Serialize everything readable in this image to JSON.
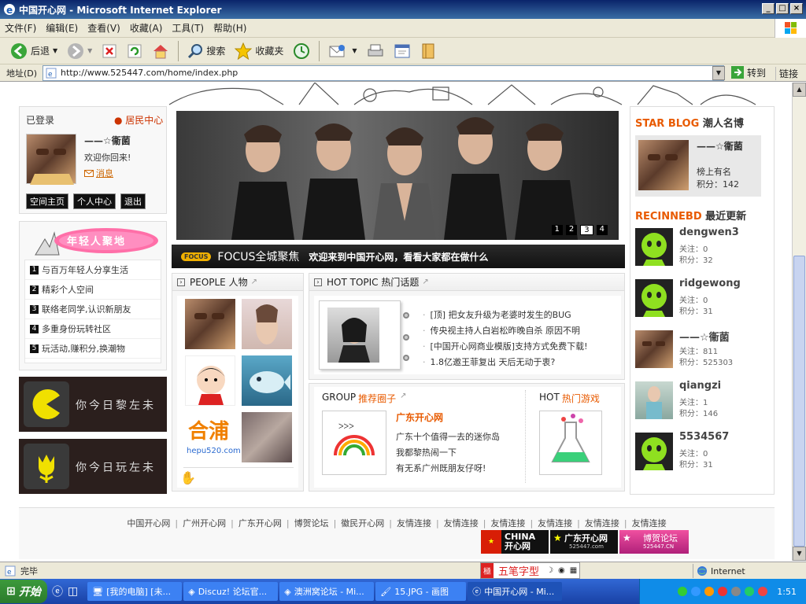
{
  "window": {
    "title": "中国开心网 - Microsoft Internet Explorer",
    "min": "_",
    "max": "□",
    "close": "×"
  },
  "menu": [
    "文件(F)",
    "编辑(E)",
    "查看(V)",
    "收藏(A)",
    "工具(T)",
    "帮助(H)"
  ],
  "toolbar": {
    "back": "后退",
    "search": "搜索",
    "favorites": "收藏夹"
  },
  "address": {
    "label": "地址(D)",
    "url": "http://www.525447.com/home/index.php",
    "go": "转到",
    "links": "链接"
  },
  "login": {
    "status": "已登录",
    "center": "居民中心",
    "name": "——☆衞菌",
    "welcome": "欢迎你回来!",
    "message": "消息",
    "btn_home": "空间主页",
    "btn_personal": "个人中心",
    "btn_logout": "退出"
  },
  "youth": {
    "banner_text": "年轻人聚地",
    "items": [
      {
        "n": "1",
        "t": "与百万年轻人分享生活"
      },
      {
        "n": "2",
        "t": "精彩个人空间"
      },
      {
        "n": "3",
        "t": "联络老同学,认识新朋友"
      },
      {
        "n": "4",
        "t": "多重身份玩转社区"
      },
      {
        "n": "5",
        "t": "玩活动,赚积分,换潮物"
      }
    ]
  },
  "promo": [
    "你今日黎左未",
    "你今日玩左未"
  ],
  "slider": {
    "pages": [
      "1",
      "2",
      "3",
      "4"
    ],
    "active": "3"
  },
  "focus": {
    "badge": "FOCUS",
    "title": "FOCUS全城聚焦",
    "text": "欢迎来到中国开心网，看看大家都在做什么"
  },
  "people": {
    "title": "PEOPLE 人物",
    "logo_text": "合浦",
    "logo_sub": "hepu520.com"
  },
  "hottopic": {
    "title": "HOT TOPIC 热门话题",
    "items": [
      "[顶] 把女友升级为老婆时发生的BUG",
      "传央视主持人白岩松昨晚自杀 原因不明",
      "[中国开心网商业模版]支持方式免费下载!",
      "1.8亿邀王菲复出 天后无动于衷?"
    ]
  },
  "group": {
    "title_en": "GROUP",
    "title_cn": "推荐圈子",
    "name": "广东开心网",
    "desc": [
      "广东十个值得一去的迷你岛",
      "我都黎热闹一下",
      "有无系广州既朋友仔呀!"
    ],
    "hot_en": "HOT",
    "hot_cn": "热门游戏"
  },
  "starblog": {
    "title_en": "STAR BLOG",
    "title_cn": "潮人名博",
    "name": "——☆衞菌",
    "rank": "榜上有名",
    "score_label": "积分：",
    "score": "142"
  },
  "recent": {
    "title_en": "RECINNEBD",
    "title_cn": "最近更新",
    "follow": "关注：",
    "score": "积分：",
    "users": [
      {
        "name": "dengwen3",
        "follow": "0",
        "score": "32",
        "av": "green"
      },
      {
        "name": "ridgewong",
        "follow": "0",
        "score": "31",
        "av": "green"
      },
      {
        "name": "——☆衞菌",
        "follow": "811",
        "score": "525303",
        "av": "photo"
      },
      {
        "name": "qiangzi",
        "follow": "1",
        "score": "146",
        "av": "photo2"
      },
      {
        "name": "5534567",
        "follow": "0",
        "score": "31",
        "av": "green"
      }
    ]
  },
  "footer": {
    "links": [
      "中国开心网",
      "广州开心网",
      "广东开心网",
      "博贺论坛",
      "徽民开心网",
      "友情连接",
      "友情连接",
      "友情连接",
      "友情连接",
      "友情连接",
      "友情连接"
    ],
    "logo1": "CHINA 开心网",
    "logo2": "广东开心网",
    "logo2_sub": "525447.com",
    "logo3": "博贺论坛",
    "logo3_sub": "525447.CN"
  },
  "status": {
    "done": "完毕",
    "ime": "五笔字型",
    "zone": "Internet"
  },
  "taskbar": {
    "start": "开始",
    "tasks": [
      "[我的电脑] [未...",
      "Discuz! 论坛官...",
      "澳洲窝论坛 - Mi...",
      "15.JPG - 画图",
      "中国开心网 - Mi..."
    ],
    "clock": "1:51"
  },
  "colors": {
    "accent": "#e85a00",
    "dark_bar": "#1a1a1a",
    "ie_blue": "#0a246a"
  }
}
